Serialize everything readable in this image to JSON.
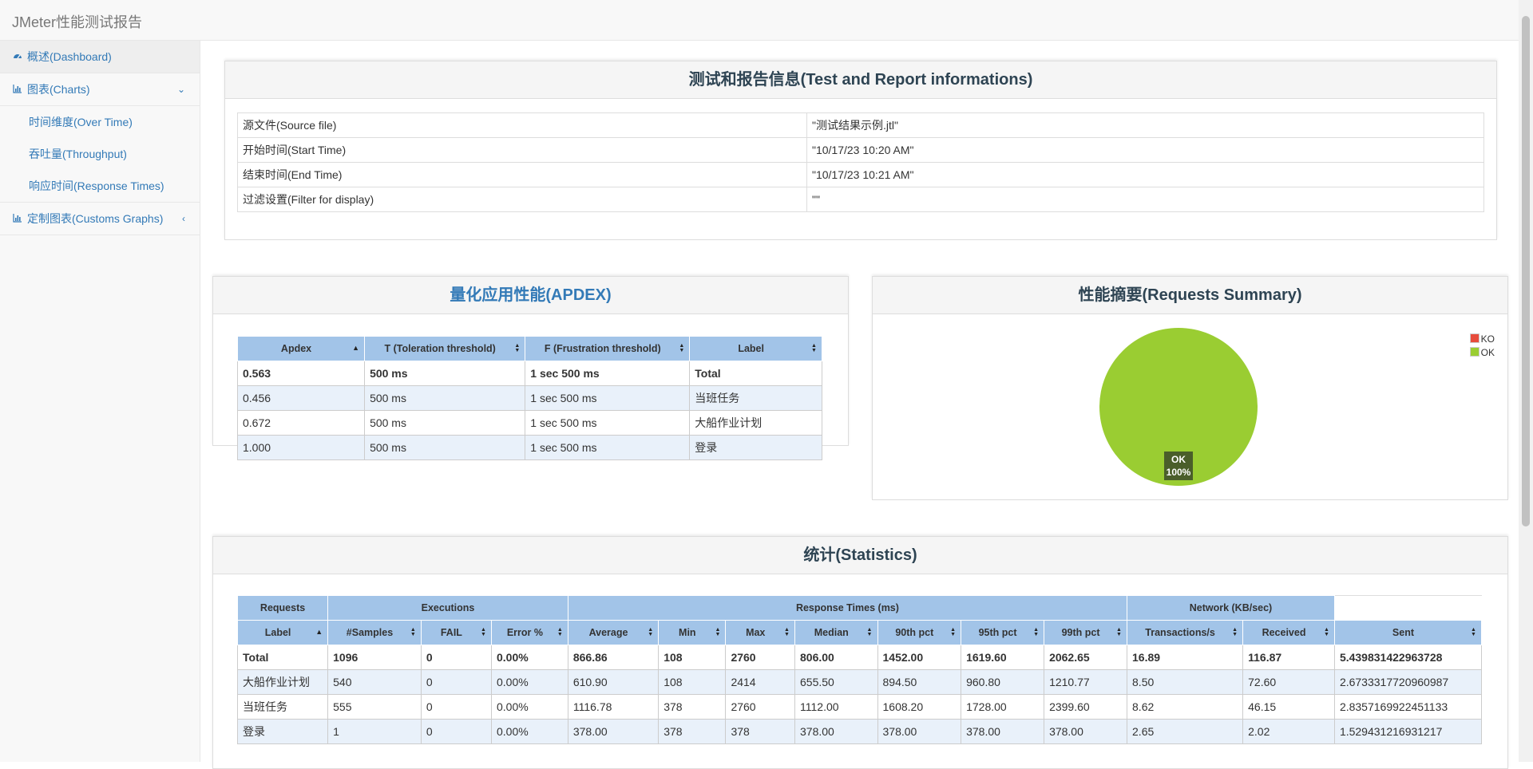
{
  "app": {
    "title": "JMeter性能测试报告"
  },
  "sidebar": {
    "dashboard": {
      "label": "概述(Dashboard)",
      "icon": "dashboard-icon"
    },
    "charts": {
      "label": "图表(Charts)",
      "icon": "bar-chart-icon",
      "chevron": "chevron-down-icon",
      "children": [
        "时间维度(Over Time)",
        "吞吐量(Throughput)",
        "响应时间(Response Times)"
      ]
    },
    "custom": {
      "label": "定制图表(Customs Graphs)",
      "icon": "bar-chart-icon",
      "chevron": "chevron-left-icon"
    }
  },
  "report_info": {
    "title": "测试和报告信息(Test and Report informations)",
    "rows": [
      {
        "key": "源文件(Source file)",
        "value": "\"测试结果示例.jtl\""
      },
      {
        "key": "开始时间(Start Time)",
        "value": "\"10/17/23 10:20 AM\""
      },
      {
        "key": "结束时间(End Time)",
        "value": "\"10/17/23 10:21 AM\""
      },
      {
        "key": "过滤设置(Filter for display)",
        "value": "\"\""
      }
    ]
  },
  "apdex": {
    "title": "量化应用性能(APDEX)",
    "headers": [
      "Apdex",
      "T (Toleration threshold)",
      "F (Frustration threshold)",
      "Label"
    ],
    "rows": [
      [
        "0.563",
        "500 ms",
        "1 sec 500 ms",
        "Total"
      ],
      [
        "0.456",
        "500 ms",
        "1 sec 500 ms",
        "当班任务"
      ],
      [
        "0.672",
        "500 ms",
        "1 sec 500 ms",
        "大船作业计划"
      ],
      [
        "1.000",
        "500 ms",
        "1 sec 500 ms",
        "登录"
      ]
    ]
  },
  "summary": {
    "title": "性能摘要(Requests Summary)",
    "legend": [
      {
        "label": "KO",
        "color": "#e74c3c"
      },
      {
        "label": "OK",
        "color": "#9acd32"
      }
    ],
    "slice_label": "OK",
    "slice_pct": "100%"
  },
  "chart_data": {
    "type": "pie",
    "categories": [
      "KO",
      "OK"
    ],
    "values": [
      0,
      100
    ],
    "colors": [
      "#e74c3c",
      "#9acd32"
    ],
    "title": "性能摘要(Requests Summary)",
    "legend_position": "top-right"
  },
  "statistics": {
    "title": "统计(Statistics)",
    "groups": [
      "Requests",
      "Executions",
      "Response Times (ms)",
      "Network (KB/sec)"
    ],
    "headers": [
      "Label",
      "#Samples",
      "FAIL",
      "Error %",
      "Average",
      "Min",
      "Max",
      "Median",
      "90th pct",
      "95th pct",
      "99th pct",
      "Transactions/s",
      "Received",
      "Sent"
    ],
    "rows": [
      [
        "Total",
        "1096",
        "0",
        "0.00%",
        "866.86",
        "108",
        "2760",
        "806.00",
        "1452.00",
        "1619.60",
        "2062.65",
        "16.89",
        "116.87",
        "5.439831422963728"
      ],
      [
        "大船作业计划",
        "540",
        "0",
        "0.00%",
        "610.90",
        "108",
        "2414",
        "655.50",
        "894.50",
        "960.80",
        "1210.77",
        "8.50",
        "72.60",
        "2.6733317720960987"
      ],
      [
        "当班任务",
        "555",
        "0",
        "0.00%",
        "1116.78",
        "378",
        "2760",
        "1112.00",
        "1608.20",
        "1728.00",
        "2399.60",
        "8.62",
        "46.15",
        "2.8357169922451133"
      ],
      [
        "登录",
        "1",
        "0",
        "0.00%",
        "378.00",
        "378",
        "378",
        "378.00",
        "378.00",
        "378.00",
        "378.00",
        "2.65",
        "2.02",
        "1.529431216931217"
      ]
    ]
  }
}
